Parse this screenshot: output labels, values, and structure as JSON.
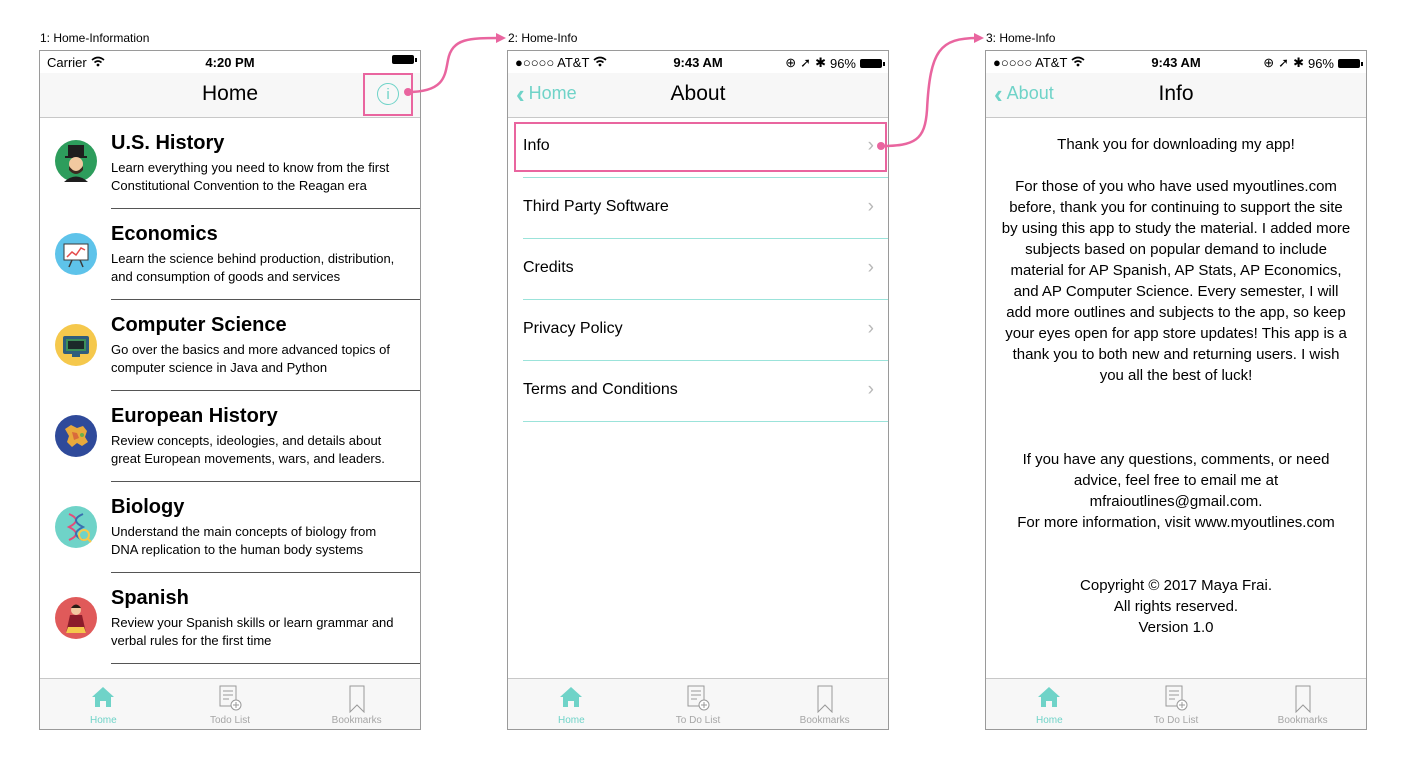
{
  "colors": {
    "accent": "#6fd3c8",
    "highlight": "#e9659f",
    "divider_teal": "#9be3da"
  },
  "screens": [
    {
      "label": "1: Home-Information",
      "status": {
        "carrier": "Carrier",
        "time": "4:20 PM"
      },
      "nav_title": "Home",
      "info_icon": "i",
      "subjects": [
        {
          "title": "U.S. History",
          "desc": "Learn everything you need to know from the first Constitutional Convention to the Reagan era",
          "icon": "lincoln-avatar-icon"
        },
        {
          "title": "Economics",
          "desc": "Learn the science behind production, distribution, and consumption of goods and services",
          "icon": "chart-board-icon"
        },
        {
          "title": "Computer Science",
          "desc": "Go over the basics and more advanced topics of computer science in Java and Python",
          "icon": "computer-monitor-icon"
        },
        {
          "title": "European History",
          "desc": "Review concepts, ideologies, and details about great European movements, wars, and leaders.",
          "icon": "europe-map-icon"
        },
        {
          "title": "Biology",
          "desc": "Understand the main concepts of biology from DNA replication to the human body systems",
          "icon": "dna-icon"
        },
        {
          "title": "Spanish",
          "desc": "Review your Spanish skills or learn grammar and verbal rules for the first time",
          "icon": "flamenco-dancer-icon"
        }
      ],
      "tabs": [
        "Home",
        "Todo List",
        "Bookmarks"
      ]
    },
    {
      "label": "2: Home-Info",
      "status": {
        "carrier": "●○○○○ AT&T",
        "time": "9:43 AM",
        "battery": "96%"
      },
      "back": "Home",
      "nav_title": "About",
      "rows": [
        "Info",
        "Third Party Software",
        "Credits",
        "Privacy Policy",
        "Terms and Conditions"
      ],
      "tabs": [
        "Home",
        "To Do List",
        "Bookmarks"
      ]
    },
    {
      "label": "3: Home-Info",
      "status": {
        "carrier": "●○○○○ AT&T",
        "time": "9:43 AM",
        "battery": "96%"
      },
      "back": "About",
      "nav_title": "Info",
      "body": "Thank you for downloading my app!\n\nFor those of you who have used myoutlines.com before, thank you for continuing to support the site by using this app to study the material. I added more subjects based on popular demand to include material for AP Spanish, AP Stats, AP Economics, and AP Computer Science. Every semester, I will add more outlines and subjects to the app, so keep your eyes open for app store updates! This app is a thank you to both new and returning users. I wish you all the best of luck!\n\n\n\nIf you have any questions, comments, or need advice, feel free to email me at mfraioutlines@gmail.com.\nFor more information, visit www.myoutlines.com\n\n\nCopyright © 2017 Maya Frai.\nAll rights reserved.\nVersion 1.0",
      "tabs": [
        "Home",
        "To Do List",
        "Bookmarks"
      ]
    }
  ]
}
